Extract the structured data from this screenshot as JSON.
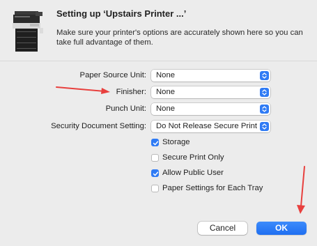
{
  "dialog": {
    "title": "Setting up ‘Upstairs Printer ...’",
    "description": "Make sure your printer's options are accurately shown here so you can take full advantage of them."
  },
  "options": [
    {
      "label": "Paper Source Unit:",
      "value": "None"
    },
    {
      "label": "Finisher:",
      "value": "None"
    },
    {
      "label": "Punch Unit:",
      "value": "None"
    },
    {
      "label": "Security Document Setting:",
      "value": "Do Not Release Secure Print"
    }
  ],
  "checkboxes": [
    {
      "label": "Storage",
      "checked": true
    },
    {
      "label": "Secure Print Only",
      "checked": false
    },
    {
      "label": "Allow Public User",
      "checked": true
    },
    {
      "label": "Paper Settings for Each Tray",
      "checked": false
    }
  ],
  "buttons": {
    "cancel": "Cancel",
    "ok": "OK"
  },
  "colors": {
    "accent": "#2f7bf5",
    "annotation": "#e8403e",
    "background": "#ececec"
  },
  "icons": {
    "printer": "printer-icon",
    "select_stepper": "chevron-up-down-icon",
    "checkmark": "checkmark-icon",
    "annotation_arrow": "red-arrow-icon"
  }
}
